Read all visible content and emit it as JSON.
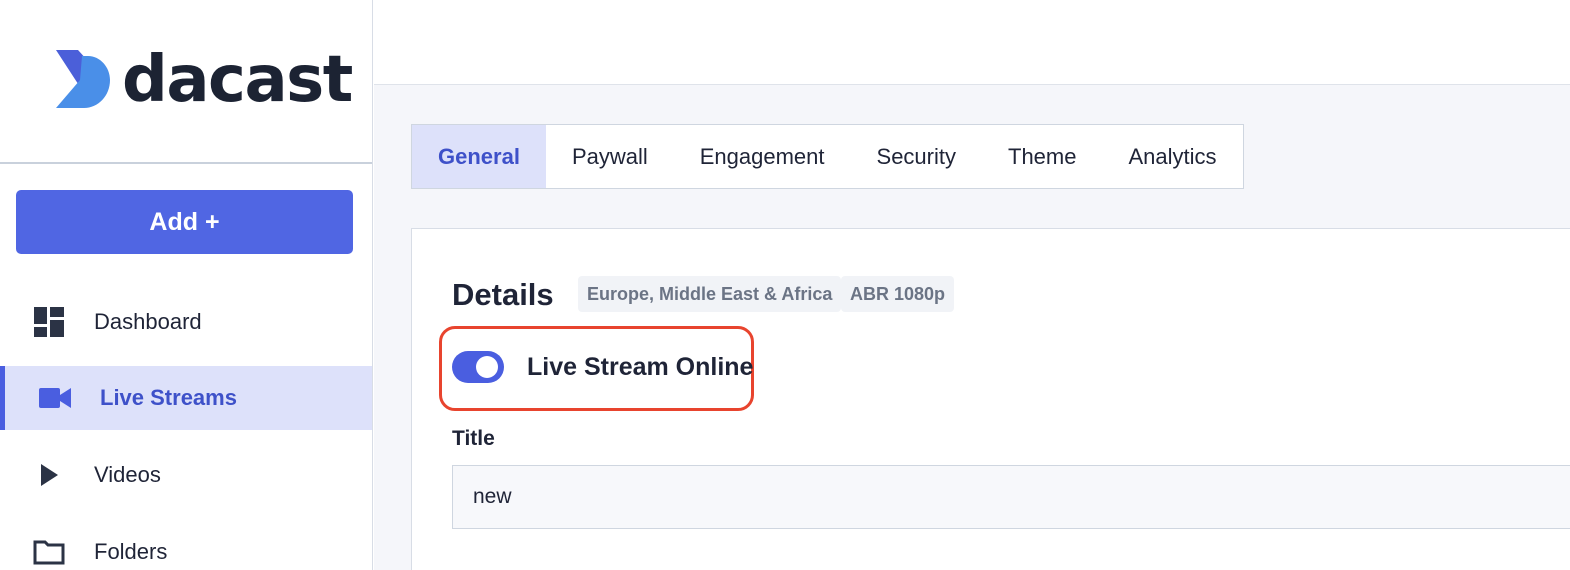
{
  "brand": {
    "name": "dacast",
    "colors": {
      "primary": "#5066e3",
      "active_bg": "#dde1fa",
      "active_text": "#3e51c9",
      "highlight": "#e8442e"
    }
  },
  "sidebar": {
    "add_button": "Add +",
    "items": [
      {
        "label": "Dashboard",
        "icon": "dashboard-icon",
        "active": false
      },
      {
        "label": "Live Streams",
        "icon": "video-camera-icon",
        "active": true
      },
      {
        "label": "Videos",
        "icon": "play-icon",
        "active": false
      },
      {
        "label": "Folders",
        "icon": "folder-icon",
        "active": false
      }
    ]
  },
  "main": {
    "tabs": [
      {
        "label": "General",
        "active": true
      },
      {
        "label": "Paywall",
        "active": false
      },
      {
        "label": "Engagement",
        "active": false
      },
      {
        "label": "Security",
        "active": false
      },
      {
        "label": "Theme",
        "active": false
      },
      {
        "label": "Analytics",
        "active": false
      }
    ],
    "details": {
      "heading": "Details",
      "region_badge": "Europe, Middle East & Africa",
      "quality_badge": "ABR 1080p",
      "online_toggle": {
        "label": "Live Stream Online",
        "on": true
      },
      "title_field": {
        "label": "Title",
        "value": "new"
      }
    }
  }
}
